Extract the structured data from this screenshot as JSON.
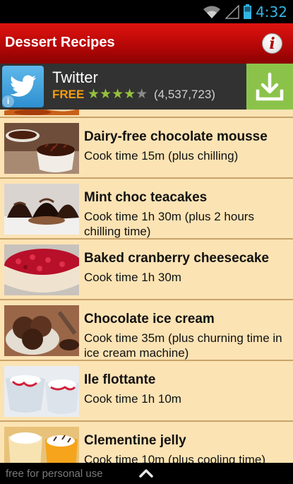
{
  "status": {
    "time": "4:32"
  },
  "header": {
    "title": "Dessert Recipes",
    "info_glyph": "i"
  },
  "ad": {
    "app_name": "Twitter",
    "price": "FREE",
    "rating": 4,
    "rating_max": 5,
    "rating_count": "(4,537,723)",
    "info_glyph": "i",
    "accent": "#8bc34a"
  },
  "recipes": [
    {
      "title": "",
      "subtitle": ""
    },
    {
      "title": "Dairy-free chocolate mousse",
      "subtitle": "Cook time 15m (plus chilling)"
    },
    {
      "title": "Mint choc teacakes",
      "subtitle": "Cook time 1h 30m (plus 2 hours chilling time)"
    },
    {
      "title": "Baked cranberry cheesecake",
      "subtitle": "Cook time 1h 30m"
    },
    {
      "title": "Chocolate ice cream",
      "subtitle": "Cook time 35m (plus churning time in ice cream machine)"
    },
    {
      "title": "Ile flottante",
      "subtitle": "Cook time 1h 10m"
    },
    {
      "title": "Clementine jelly",
      "subtitle": "Cook time 10m (plus cooling time)"
    }
  ],
  "footer": {
    "text": "free for personal use"
  },
  "colors": {
    "header": "#c00808",
    "list_bg": "#fbe3b4",
    "status_accent": "#33b5e5"
  }
}
